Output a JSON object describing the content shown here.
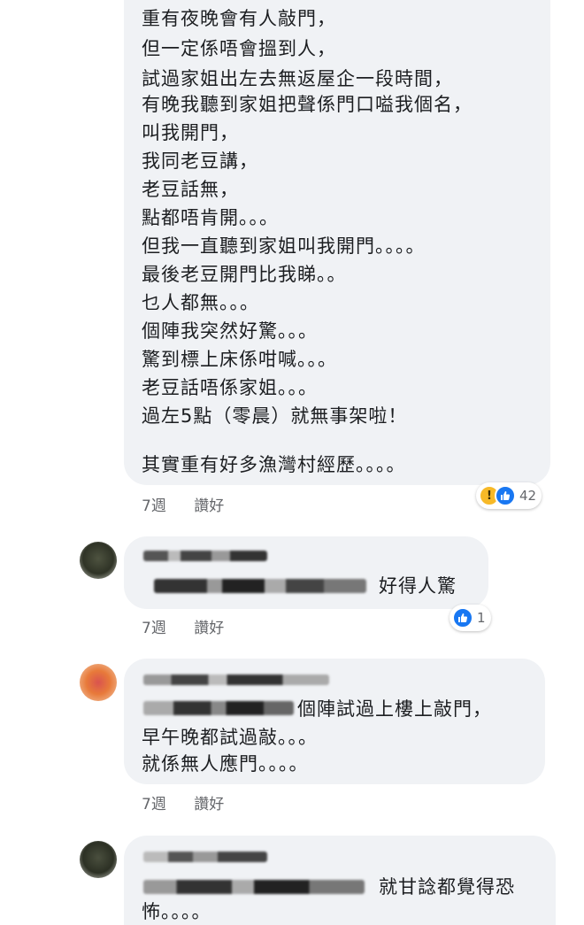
{
  "comment1": {
    "lines": [
      "重有夜晚會有人敲門，",
      "但一定係唔會搵到人，",
      "試過家姐出左去無返屋企一段時間，",
      "有晚我聽到家姐把聲係門口嗌我個名，",
      "叫我開門，",
      "我同老豆講，",
      "老豆話無，",
      "點都唔肯開。。。",
      "但我一直聽到家姐叫我開門。。。。",
      "最後老豆開門比我睇。。",
      "乜人都無。。。",
      "個陣我突然好驚。。。",
      "驚到標上床係咁喊。。。",
      "老豆話唔係家姐。。。",
      "過左5點（零晨）就無事架啦！",
      "",
      "其實重有好多漁灣村經歷。。。。"
    ],
    "time": "7週",
    "like_label": "讚好",
    "reactions": {
      "icons": [
        "wow-icon",
        "like-icon"
      ],
      "count": "42"
    }
  },
  "comment2": {
    "text": "好得人驚",
    "time": "7週",
    "like_label": "讚好",
    "reactions": {
      "icons": [
        "like-icon"
      ],
      "count": "1"
    }
  },
  "comment3": {
    "lines": [
      "個陣試過上樓上敲門，",
      "早午晚都試過敲。。。",
      "就係無人應門。。。。"
    ],
    "time": "7週",
    "like_label": "讚好"
  },
  "comment4": {
    "lines": [
      "就甘諗都覺得恐",
      "怖。。。。"
    ]
  },
  "colors": {
    "bubble": "#f0f2f5",
    "meta_text": "#65676b",
    "like_blue": "#1877f2",
    "wow_yellow": "#f7b928"
  }
}
